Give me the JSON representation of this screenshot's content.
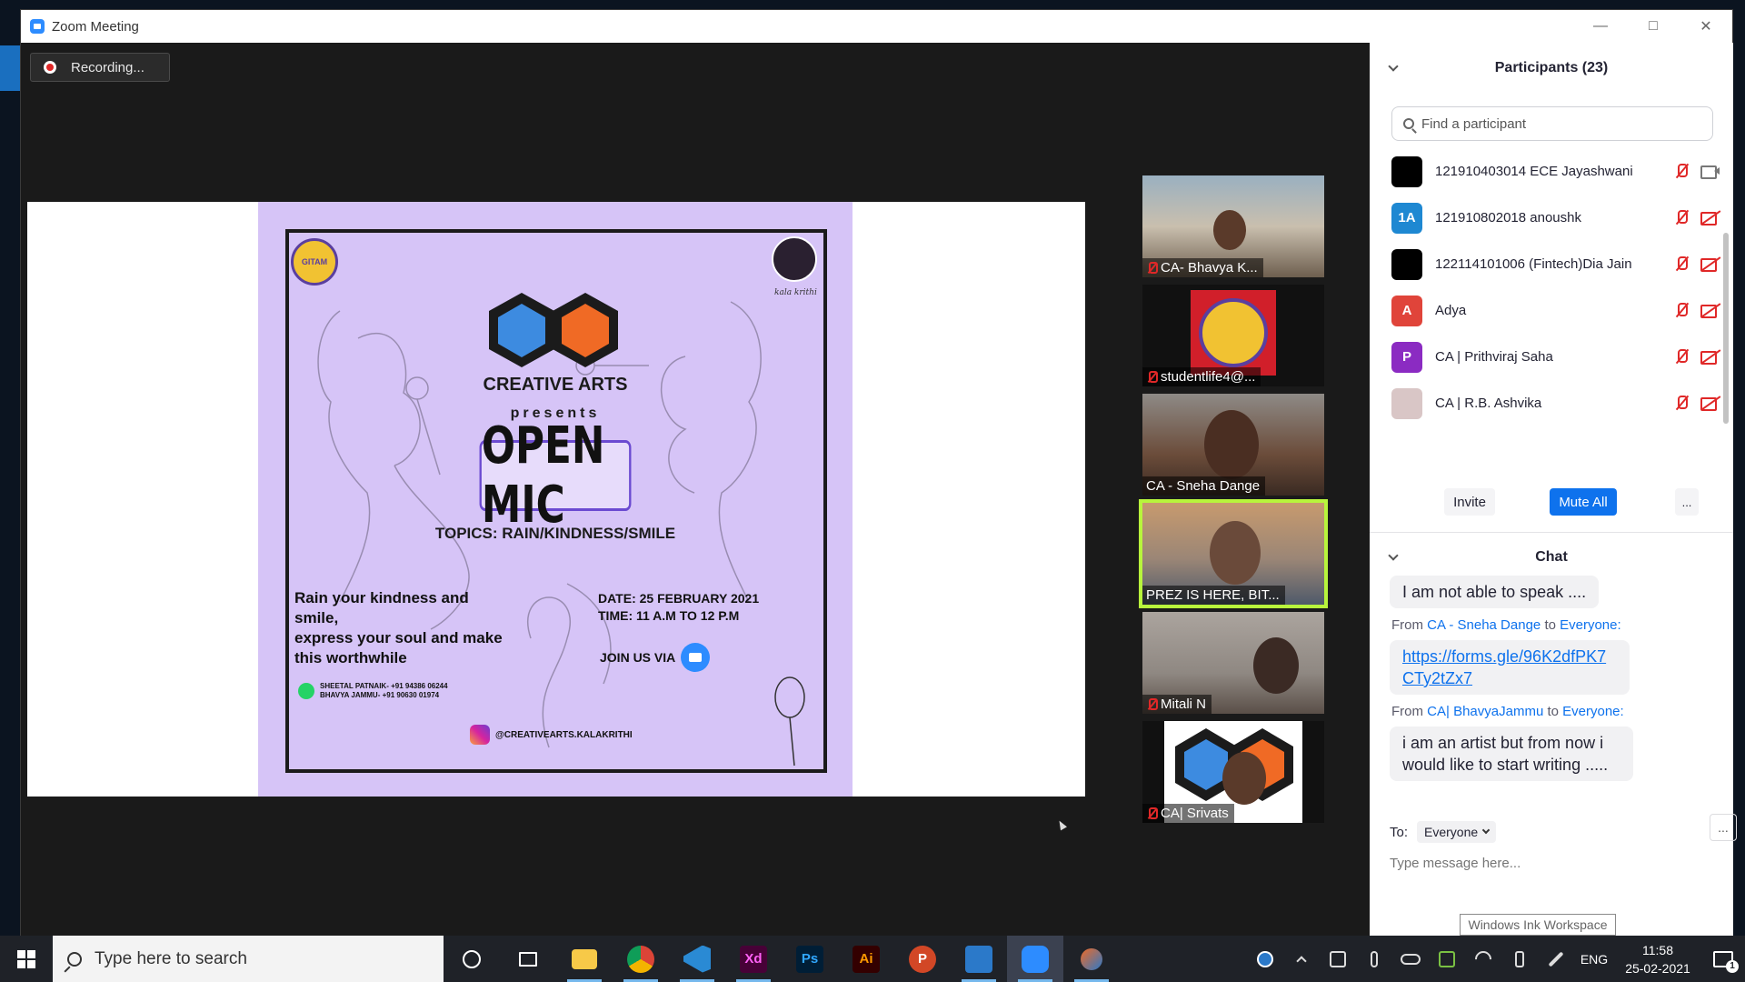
{
  "window": {
    "title": "Zoom Meeting"
  },
  "recording": {
    "label": "Recording..."
  },
  "poster": {
    "gitam_text": "GITAM",
    "kalakrithi_text": "kala krithi",
    "org": "CREATIVE ARTS",
    "presents": "presents",
    "event": "OPEN MIC",
    "topics": "TOPICS: RAIN/KINDNESS/SMILE",
    "tagline": "Rain your kindness and smile,\nexpress your soul and make this worthwhile",
    "date": "DATE: 25 FEBRUARY 2021",
    "time": "TIME: 11 A.M TO 12 P.M",
    "join": "JOIN US VIA",
    "contact1": "SHEETAL PATNAIK- +91 94386 06244",
    "contact2": "BHAVYA JAMMU- +91 90630 01974",
    "instagram": "@CREATIVEARTS.KALAKRITHI"
  },
  "gallery": [
    {
      "name": "CA- Bhavya K...",
      "muted": true
    },
    {
      "name": "studentlife4@...",
      "muted": true
    },
    {
      "name": "CA - Sneha Dange",
      "muted": false
    },
    {
      "name": "PREZ IS HERE, BIT...",
      "muted": false,
      "active": true
    },
    {
      "name": "Mitali N",
      "muted": true
    },
    {
      "name": "CA| Srivats",
      "muted": true
    }
  ],
  "participants": {
    "title": "Participants (23)",
    "search_placeholder": "Find a participant",
    "items": [
      {
        "name": "121910403014 ECE Jayashwani",
        "avatar": "",
        "color": "#000000",
        "mic": "muted",
        "cam": "on"
      },
      {
        "name": "121910802018 anoushk",
        "avatar": "1A",
        "color": "#1e88d2",
        "mic": "muted",
        "cam": "off"
      },
      {
        "name": "122114101006 (Fintech)Dia Jain",
        "avatar": "",
        "color": "#000000",
        "mic": "muted",
        "cam": "off"
      },
      {
        "name": "Adya",
        "avatar": "A",
        "color": "#e0443a",
        "mic": "muted",
        "cam": "off"
      },
      {
        "name": "CA | Prithviraj Saha",
        "avatar": "P",
        "color": "#8b2bc2",
        "mic": "muted",
        "cam": "off"
      },
      {
        "name": "CA | R.B. Ashvika",
        "avatar": "",
        "color": "#d9c6c6",
        "mic": "muted",
        "cam": "off"
      }
    ],
    "invite_label": "Invite",
    "mute_all_label": "Mute All",
    "more_label": "..."
  },
  "chat": {
    "title": "Chat",
    "messages": [
      {
        "text": "I am not able to speak ...."
      },
      {
        "from": "CA - Sneha Dange",
        "to": "Everyone:",
        "text": "https://forms.gle/96K2dfPK7CTy2tZx7",
        "is_link": true
      },
      {
        "from": "CA| BhavyaJammu",
        "to": "Everyone:",
        "text": "i am an artist but from now i would like to start writing ....."
      }
    ],
    "from_prefix": "From",
    "to_word": "to",
    "to_label": "To:",
    "to_value": "Everyone",
    "input_placeholder": "Type message here...",
    "more_label": "..."
  },
  "tooltip": "Windows Ink Workspace",
  "taskbar": {
    "search_placeholder": "Type here to search",
    "apps": [
      "cortana-icon",
      "task-view-icon",
      "file-explorer-icon",
      "chrome-icon",
      "vscode-icon",
      "adobe-xd-icon",
      "photoshop-icon",
      "illustrator-icon",
      "powerpoint-icon",
      "photos-icon",
      "zoom-icon",
      "snip-sketch-icon"
    ],
    "app_labels": {
      "xd": "Xd",
      "ps": "Ps",
      "ai": "Ai",
      "pp": "P"
    },
    "lang": "ENG",
    "time": "11:58",
    "date": "25-02-2021",
    "notification_count": "1"
  }
}
